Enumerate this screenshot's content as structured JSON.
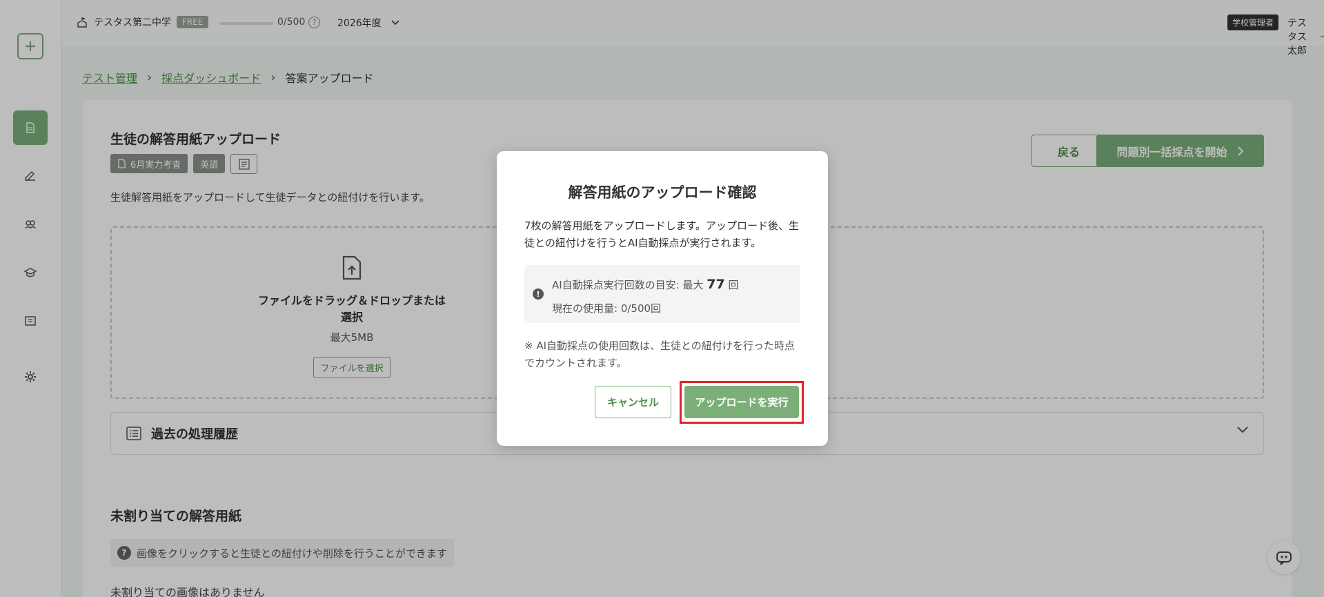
{
  "topbar": {
    "school_name": "テスタス第二中学",
    "plan_badge": "FREE",
    "usage": "0/500",
    "usage_fraction": 0,
    "help": "?",
    "year": "2026年度",
    "role_badge": "学校管理者",
    "user_name": "テスタス 太郎"
  },
  "sidebar": {
    "items": [
      {
        "icon": "document-icon",
        "active": true
      },
      {
        "icon": "pen-icon",
        "active": false
      },
      {
        "icon": "group-icon",
        "active": false
      },
      {
        "icon": "graduation-icon",
        "active": false
      },
      {
        "icon": "book-icon",
        "active": false
      },
      {
        "icon": "gear-icon",
        "active": false
      }
    ]
  },
  "breadcrumb": {
    "items": [
      "テスト管理",
      "採点ダッシュボード",
      "答案アップロード"
    ]
  },
  "page": {
    "title": "生徒の解答用紙アップロード",
    "tag_test": "6月実力考査",
    "tag_subject": "英語",
    "description": "生徒解答用紙をアップロードして生徒データとの紐付けを行います。",
    "back_label": "戻る",
    "start_label": "問題別一括採点を開始"
  },
  "dropzone": {
    "title": "ファイルをドラッグ＆ドロップまたは選択",
    "max_size": "最大5MB",
    "select_label": "ファイルを選択"
  },
  "history": {
    "label": "過去の処理履歴"
  },
  "unassigned": {
    "title": "未割り当ての解答用紙",
    "hint": "画像をクリックすると生徒との紐付けや削除を行うことができます",
    "empty": "未割り当ての画像はありません"
  },
  "modal": {
    "title": "解答用紙のアップロード確認",
    "body": "7枚の解答用紙をアップロードします。アップロード後、生徒との紐付けを行うとAI自動採点が実行されます。",
    "info_prefix": "AI自動採点実行回数の目安: 最大",
    "info_count": "77",
    "info_suffix": "回",
    "info_usage": "現在の使用量: 0/500回",
    "note": "※ AI自動採点の使用回数は、生徒との紐付けを行った時点でカウントされます。",
    "cancel_label": "キャンセル",
    "upload_label": "アップロードを実行"
  },
  "colors": {
    "accent": "#7aaf78",
    "accent_text": "#4d8f4a",
    "highlight": "#e0242a"
  }
}
